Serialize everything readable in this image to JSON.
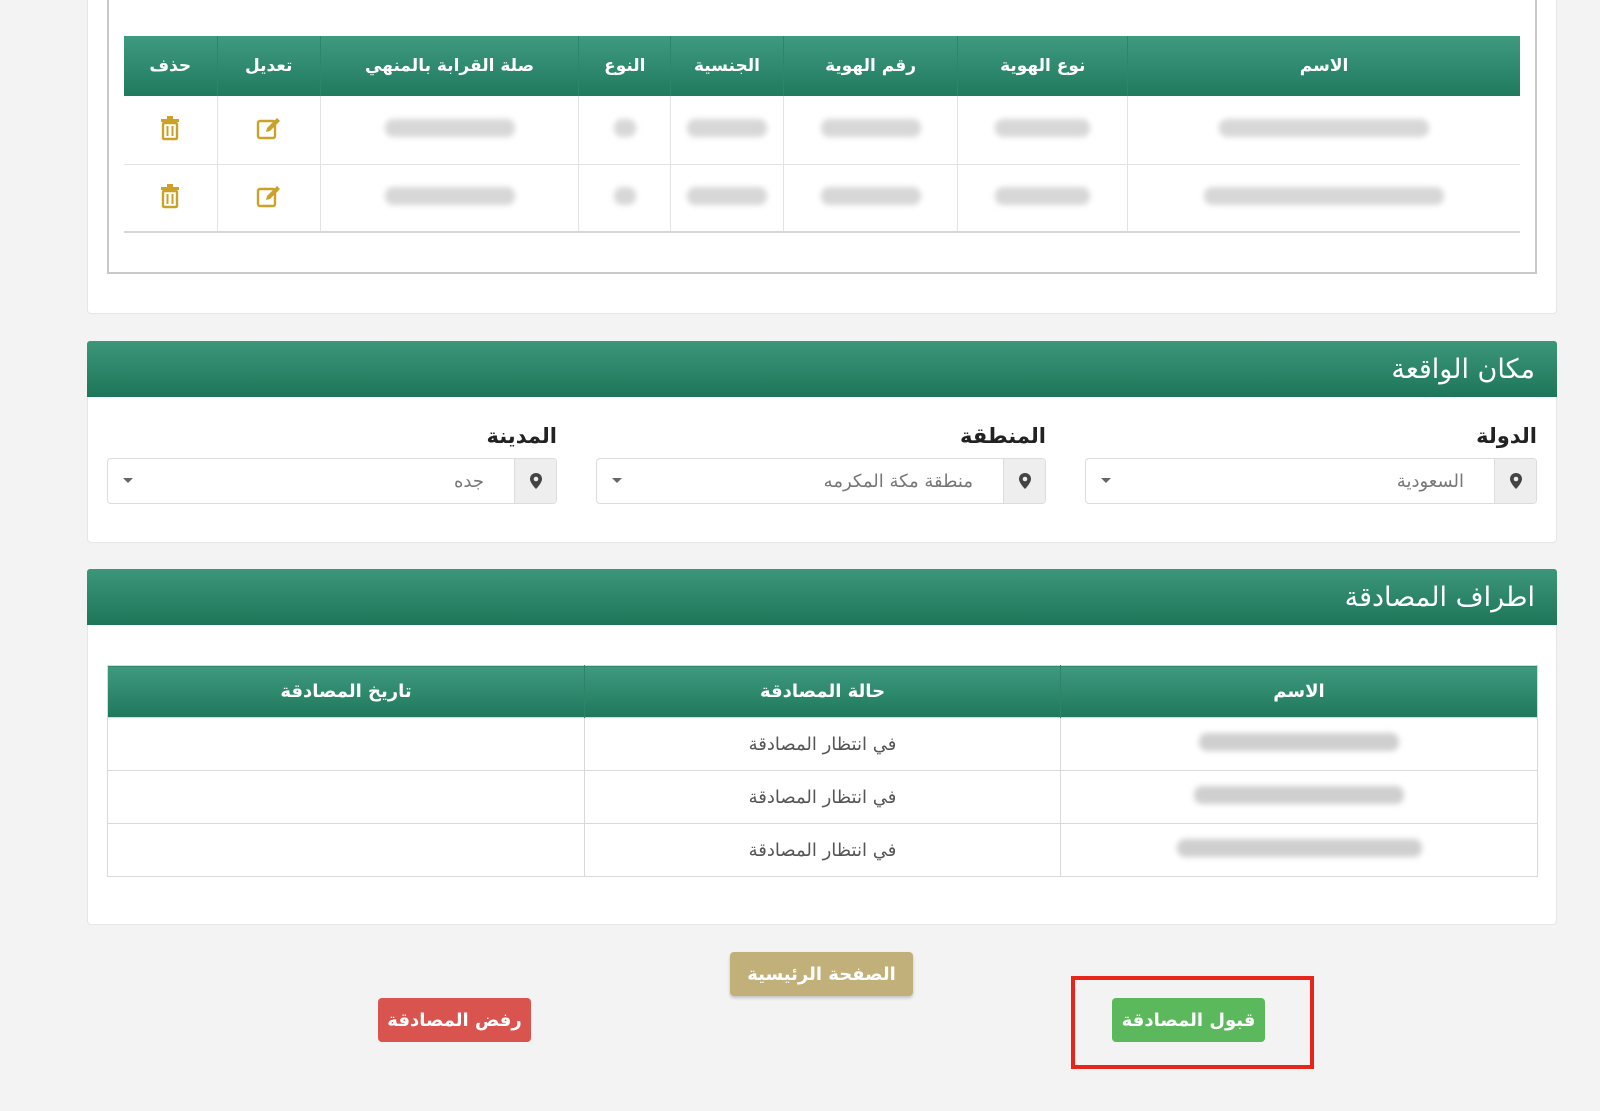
{
  "relatives_table": {
    "headers": [
      "الاسم",
      "نوع الهوية",
      "رقم الهوية",
      "الجنسية",
      "النوع",
      "صلة القرابة بالمنهي",
      "تعديل",
      "حذف"
    ],
    "rows": [
      {
        "edit_icon": "edit-icon",
        "delete_icon": "trash-icon"
      },
      {
        "edit_icon": "edit-icon",
        "delete_icon": "trash-icon"
      }
    ]
  },
  "location_section": {
    "title": "مكان الواقعة",
    "country": {
      "label": "الدولة",
      "value": "السعودية"
    },
    "region": {
      "label": "المنطقة",
      "value": "منطقة مكة المكرمه"
    },
    "city": {
      "label": "المدينة",
      "value": "جده"
    }
  },
  "parties_section": {
    "title": "اطراف المصادقة",
    "headers": [
      "الاسم",
      "حالة المصادقة",
      "تاريخ المصادقة"
    ],
    "rows": [
      {
        "status": "في انتظار المصادقة",
        "date": ""
      },
      {
        "status": "في انتظار المصادقة",
        "date": ""
      },
      {
        "status": "في انتظار المصادقة",
        "date": ""
      }
    ]
  },
  "buttons": {
    "home": "الصفحة الرئيسية",
    "accept": "قبول المصادقة",
    "reject": "رفض المصادقة"
  },
  "colors": {
    "header_green": "#1f7a5e",
    "accept_green": "#5cb85c",
    "reject_red": "#d9534f",
    "home_gold": "#c2b07a",
    "icon_gold": "#c9a227",
    "highlight_red": "#e8251b"
  }
}
